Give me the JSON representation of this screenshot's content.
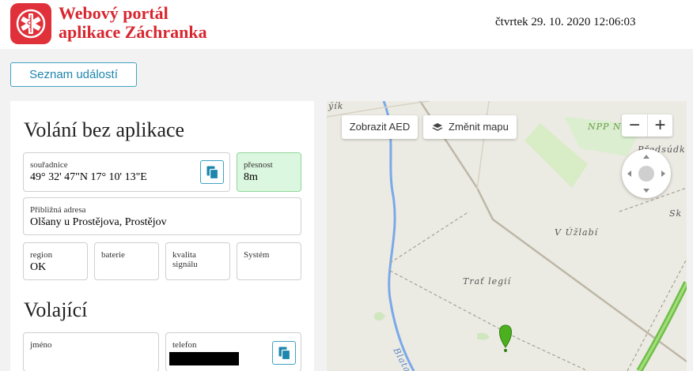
{
  "header": {
    "brand_line1": "Webový portál",
    "brand_line2": "aplikace Záchranka",
    "datetime": "čtvrtek 29. 10. 2020 12:06:03",
    "logo_color": "#e0303a"
  },
  "nav": {
    "events_button": "Seznam událostí"
  },
  "call": {
    "title": "Volání bez aplikace",
    "coordinates": {
      "label": "souřadnice",
      "value": "49° 32' 47\"N 17° 10' 13\"E",
      "copy_icon": "copy-icon"
    },
    "accuracy": {
      "label": "přesnost",
      "value": "8m"
    },
    "address": {
      "label": "Přibližná adresa",
      "value": "Olšany u Prostějova, Prostějov"
    },
    "region": {
      "label": "region",
      "value": "OK"
    },
    "battery": {
      "label": "baterie",
      "value": ""
    },
    "signal": {
      "label": "kvalita signálu",
      "value": ""
    },
    "system": {
      "label": "Systém",
      "value": ""
    }
  },
  "caller": {
    "title": "Volající",
    "name": {
      "label": "jméno",
      "value": ""
    },
    "phone": {
      "label": "telefon",
      "value": "",
      "redacted": true,
      "copy_icon": "copy-icon"
    }
  },
  "map": {
    "aed_button": "Zobrazit AED",
    "change_map_button": "Změnit mapu",
    "zoom_out": "−",
    "zoom_in": "+",
    "labels": {
      "top_left": "ýík",
      "npp": "NPP Na",
      "predsudky": "Předsúdk",
      "sk": "Sk",
      "uzlabi": "V Úžlabí",
      "trat": "Trať legií",
      "blata": "Blata"
    },
    "marker_color": "#4caf1e"
  }
}
